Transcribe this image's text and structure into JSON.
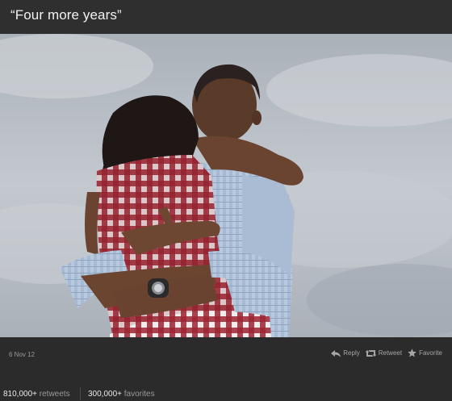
{
  "tweet": {
    "text": "“Four more years”",
    "date": "6 Nov 12"
  },
  "actions": {
    "reply": "Reply",
    "retweet": "Retweet",
    "favorite": "Favorite"
  },
  "stats": {
    "retweets_count": "810,000+",
    "retweets_label": "retweets",
    "favorites_count": "300,000+",
    "favorites_label": "favorites"
  },
  "colors": {
    "background": "#2b2b2b",
    "header": "#2f2f2f",
    "sky": "#b8bec5",
    "dress_red": "#8e1f2a",
    "shirt_blue": "#9fb4cf"
  }
}
